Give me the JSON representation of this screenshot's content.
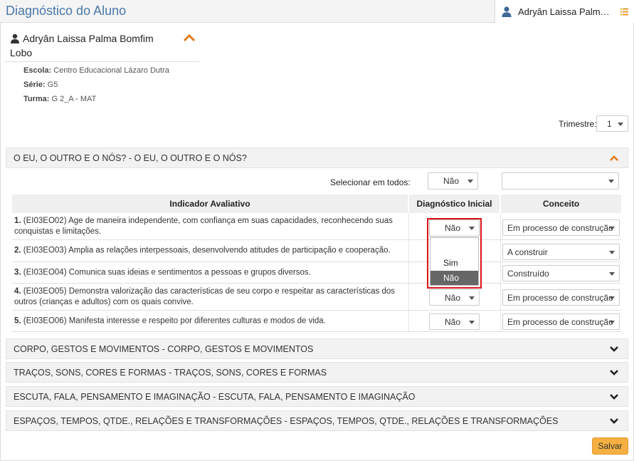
{
  "header": {
    "title": "Diagnóstico do Aluno",
    "user_name": "Adryân Laissa Palma ..."
  },
  "student": {
    "name": "Adryân Laissa Palma Bomfim Lobo",
    "escola_label": "Escola:",
    "escola": "Centro Educacional Lázaro Dutra",
    "serie_label": "Série:",
    "serie": "G5",
    "turma_label": "Turma:",
    "turma": "G 2_A - MAT"
  },
  "trimestre": {
    "label": "Trimestre:",
    "value": "1"
  },
  "section_open": {
    "title": "O EU, O OUTRO E O NÓS? - O EU, O OUTRO E O NÓS?",
    "select_all_label": "Selecionar em todos:",
    "select_all_diag": "Não",
    "select_all_conceito": ""
  },
  "table": {
    "headers": {
      "indicador": "Indicador Avaliativo",
      "diagnostico": "Diagnóstico Inicial",
      "conceito": "Conceito"
    },
    "rows": [
      {
        "num": "1.",
        "text": "(EI03EO02) Age de maneira independente, com confiança em suas capacidades, reconhecendo suas conquistas e limitações.",
        "diag": "Não",
        "conceito": "Em processo de construção"
      },
      {
        "num": "2.",
        "text": "(EI03EO03) Amplia as relações interpessoais, desenvolvendo atitudes de participação e cooperação.",
        "diag": "",
        "conceito": "A construir"
      },
      {
        "num": "3.",
        "text": "(EI03EO04) Comunica suas ideias e sentimentos a pessoas e grupos diversos.",
        "diag": "",
        "conceito": "Construído"
      },
      {
        "num": "4.",
        "text": "(EI03EO05) Demonstra valorização das características de seu corpo e respeitar as características dos outros (crianças e adultos) com os quais convive.",
        "diag": "Não",
        "conceito": "Em processo de construção"
      },
      {
        "num": "5.",
        "text": "(EI03EO06) Manifesta interesse e respeito por diferentes culturas e modos de vida.",
        "diag": "Não",
        "conceito": "Em processo de construção"
      }
    ]
  },
  "dropdown_options": {
    "blank": "",
    "sim": "Sim",
    "nao": "Não"
  },
  "sections_collapsed": [
    "CORPO, GESTOS E MOVIMENTOS - CORPO, GESTOS E MOVIMENTOS",
    "TRAÇOS, SONS, CORES E FORMAS - TRAÇOS, SONS, CORES E FORMAS",
    "ESCUTA, FALA, PENSAMENTO E IMAGINAÇÃO - ESCUTA, FALA, PENSAMENTO E IMAGINAÇÃO",
    "ESPAÇOS, TEMPOS, QTDE., RELAÇÕES E TRANSFORMAÇÕES - ESPAÇOS, TEMPOS, QTDE., RELAÇÕES E TRANSFORMAÇÕES"
  ],
  "save_label": "Salvar",
  "colors": {
    "accent_blue": "#4a78a8",
    "accent_orange": "#e07b1a",
    "save_button": "#f5b041",
    "highlight_red": "#d9141b"
  }
}
